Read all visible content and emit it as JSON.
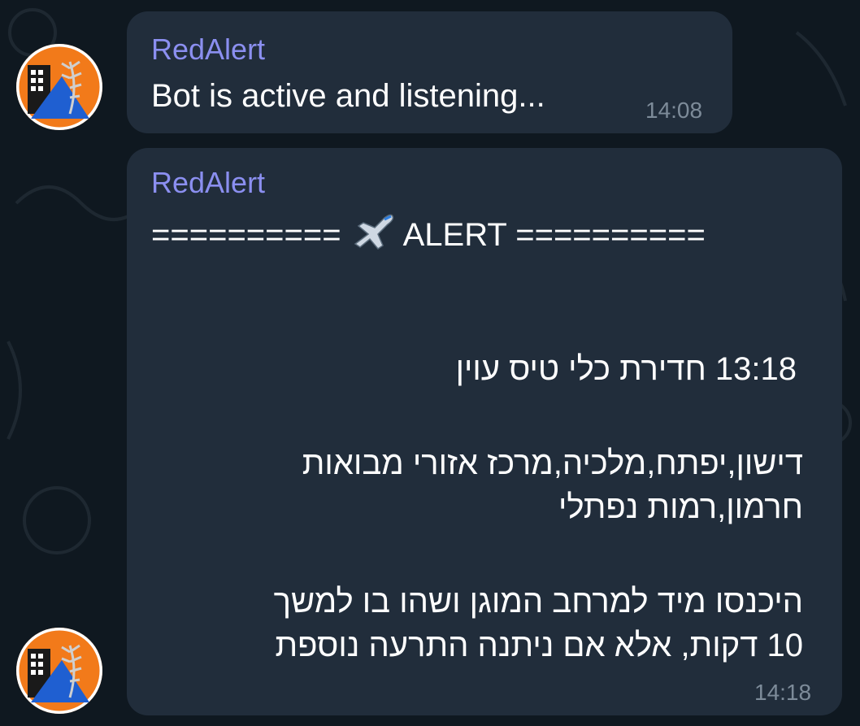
{
  "messages": [
    {
      "sender": "RedAlert",
      "text": "Bot is active and listening...",
      "time": "14:08"
    },
    {
      "sender": "RedAlert",
      "header_left": "==========",
      "header_emoji": "✈️",
      "header_right": "ALERT ==========",
      "line_title": "13:18 חדירת כלי טיס עוין",
      "line_area_1": "דישון,יפתח,מלכיה,מרכז אזורי מבואות",
      "line_area_2": "חרמון,רמות נפתלי",
      "line_instr_1": "היכנסו מיד למרחב המוגן ושהו בו למשך",
      "line_instr_2": "10 דקות, אלא אם ניתנה התרעה נוספת",
      "time": "14:18"
    }
  ],
  "colors": {
    "background": "#0f1820",
    "bubble": "#212d3b",
    "sender": "#8b8ff0",
    "timestamp": "#7d8b99",
    "avatar_orange": "#f27a1a",
    "avatar_blue": "#1f5fd1"
  }
}
